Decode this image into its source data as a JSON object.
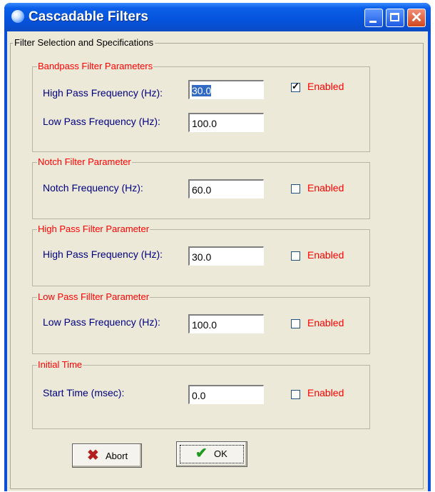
{
  "window": {
    "title": "Cascadable Filters"
  },
  "group_title": "Filter Selection and  Specifications",
  "sections": {
    "bandpass": {
      "legend": "Bandpass Filter Parameters",
      "high_label": "High Pass  Frequency (Hz):",
      "high_value": "30.0",
      "low_label": "Low Pass Frequency (Hz):",
      "low_value": "100.0",
      "enabled_label": "Enabled",
      "enabled": true
    },
    "notch": {
      "legend": "Notch Filter Parameter",
      "label": "Notch Frequency (Hz):",
      "value": "60.0",
      "enabled_label": "Enabled",
      "enabled": false
    },
    "highpass": {
      "legend": "High Pass Filter Parameter",
      "label": "High Pass Frequency (Hz):",
      "value": "30.0",
      "enabled_label": "Enabled",
      "enabled": false
    },
    "lowpass": {
      "legend": "Low Pass Fillter Parameter",
      "label": "Low Pass Frequency (Hz):",
      "value": "100.0",
      "enabled_label": "Enabled",
      "enabled": false
    },
    "initial": {
      "legend": "Initial Time",
      "label": "Start Time (msec):",
      "value": "0.0",
      "enabled_label": "Enabled",
      "enabled": false
    }
  },
  "buttons": {
    "abort_label": "Abort",
    "ok_label": "OK"
  },
  "icons": {
    "app": "globe-icon",
    "minimize": "minimize-icon",
    "maximize": "maximize-icon",
    "close": "close-icon",
    "abort": "red-x-icon",
    "ok": "green-checkmark-icon"
  },
  "colors": {
    "title_bar": "#0653dd",
    "legend_text": "#ff0000",
    "label_text": "#000080",
    "dialog_bg": "#ece9d8",
    "abort_icon": "#b31e1e",
    "ok_icon": "#1e9a1e"
  }
}
